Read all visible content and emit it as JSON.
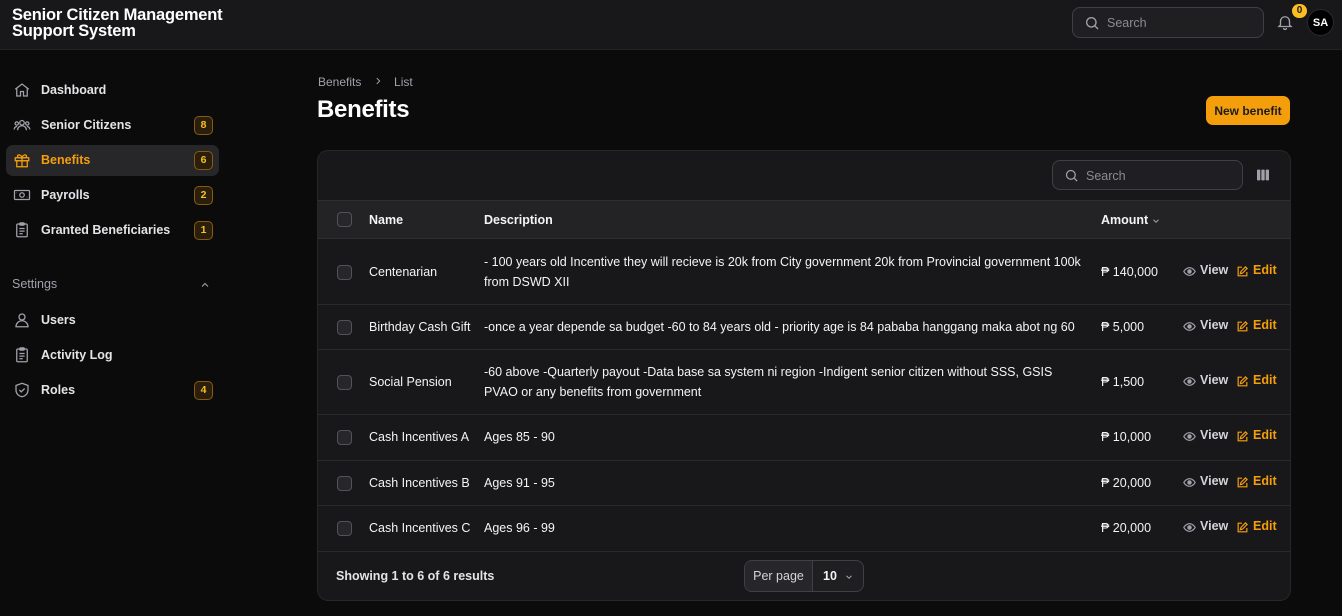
{
  "app": {
    "title": "Senior Citizen Management Support System"
  },
  "topbar": {
    "search_placeholder": "Search",
    "notification_count": "0",
    "avatar_initials": "SA"
  },
  "sidebar": {
    "items": [
      {
        "label": "Dashboard",
        "icon": "home-icon",
        "badge": ""
      },
      {
        "label": "Senior Citizens",
        "icon": "users-icon",
        "badge": "8"
      },
      {
        "label": "Benefits",
        "icon": "gift-icon",
        "badge": "6",
        "active": true
      },
      {
        "label": "Payrolls",
        "icon": "cash-icon",
        "badge": "2"
      },
      {
        "label": "Granted Beneficiaries",
        "icon": "clipboard-icon",
        "badge": "1"
      }
    ],
    "group_label": "Settings",
    "settings_items": [
      {
        "label": "Users",
        "icon": "user-icon",
        "badge": ""
      },
      {
        "label": "Activity Log",
        "icon": "clipboard-list-icon",
        "badge": ""
      },
      {
        "label": "Roles",
        "icon": "shield-icon",
        "badge": "4"
      }
    ]
  },
  "breadcrumb": {
    "parent": "Benefits",
    "current": "List"
  },
  "page": {
    "title": "Benefits",
    "new_button": "New benefit"
  },
  "table": {
    "search_placeholder": "Search",
    "columns": {
      "name": "Name",
      "description": "Description",
      "amount": "Amount"
    },
    "actions": {
      "view": "View",
      "edit": "Edit"
    },
    "rows": [
      {
        "name": "Centenarian",
        "description": "- 100 years old Incentive they will recieve is 20k from City government 20k from Provincial government 100k from DSWD XII",
        "amount": "₱ 140,000"
      },
      {
        "name": "Birthday Cash Gift",
        "description": "-once a year depende sa budget -60 to 84 years old - priority age is 84 pababa hanggang maka abot ng 60",
        "amount": "₱ 5,000"
      },
      {
        "name": "Social Pension",
        "description": "-60 above -Quarterly payout -Data base sa system ni region -Indigent senior citizen without SSS, GSIS PVAO or any benefits from government",
        "amount": "₱ 1,500"
      },
      {
        "name": "Cash Incentives A",
        "description": "Ages 85 - 90",
        "amount": "₱ 10,000"
      },
      {
        "name": "Cash Incentives B",
        "description": "Ages 91 - 95",
        "amount": "₱ 20,000"
      },
      {
        "name": "Cash Incentives C",
        "description": "Ages 96 - 99",
        "amount": "₱ 20,000"
      }
    ],
    "footer_text": "Showing 1 to 6 of 6 results",
    "per_page_label": "Per page",
    "per_page_value": "10"
  },
  "colors": {
    "accent": "#f59e0b",
    "background": "#0b0b0c",
    "surface": "#18181b"
  }
}
